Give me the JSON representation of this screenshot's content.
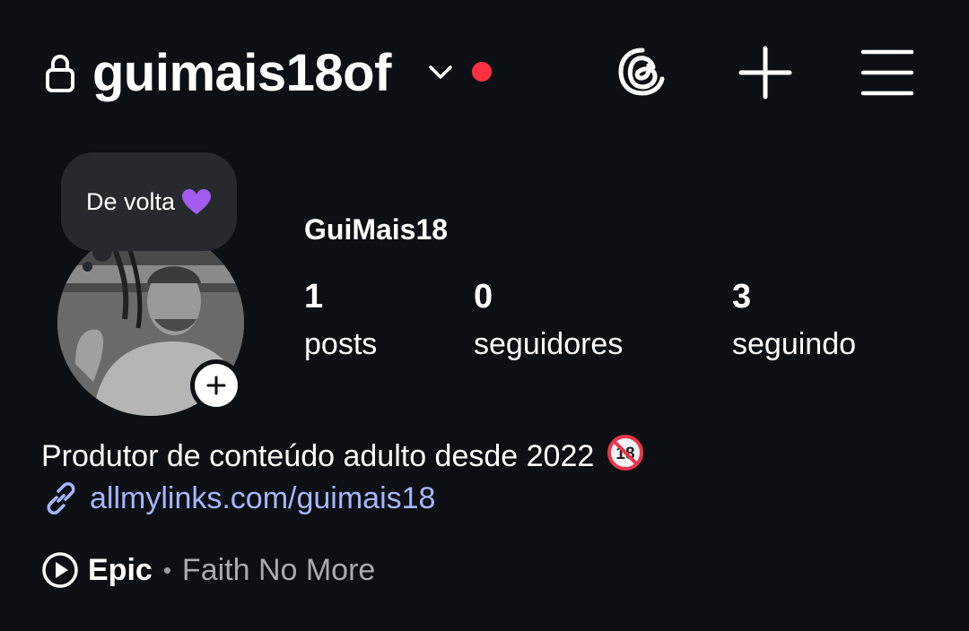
{
  "header": {
    "username": "guimais18of",
    "icons": {
      "lock": "lock-icon",
      "dropdown": "chevron-down-icon",
      "threads": "threads-icon",
      "create": "plus-icon",
      "menu": "hamburger-menu-icon"
    },
    "live_dot_color": "#ff3040"
  },
  "profile": {
    "note": "De volta",
    "note_emoji": "purple-heart-icon",
    "display_name": "GuiMais18",
    "stats": [
      {
        "value": "1",
        "label": "posts"
      },
      {
        "value": "0",
        "label": "seguidores"
      },
      {
        "value": "3",
        "label": "seguindo"
      }
    ]
  },
  "bio": {
    "text": "Produtor de conteúdo adulto desde 2022",
    "emoji": "no-one-under-eighteen-icon",
    "link": "allmylinks.com/guimais18",
    "link_color": "#a8b5ff"
  },
  "music": {
    "song": "Epic",
    "separator": "•",
    "artist": "Faith No More"
  },
  "colors": {
    "background": "#0c1014",
    "note_bubble": "#262a2f",
    "text": "#ffffff",
    "muted": "#a8acb1"
  }
}
